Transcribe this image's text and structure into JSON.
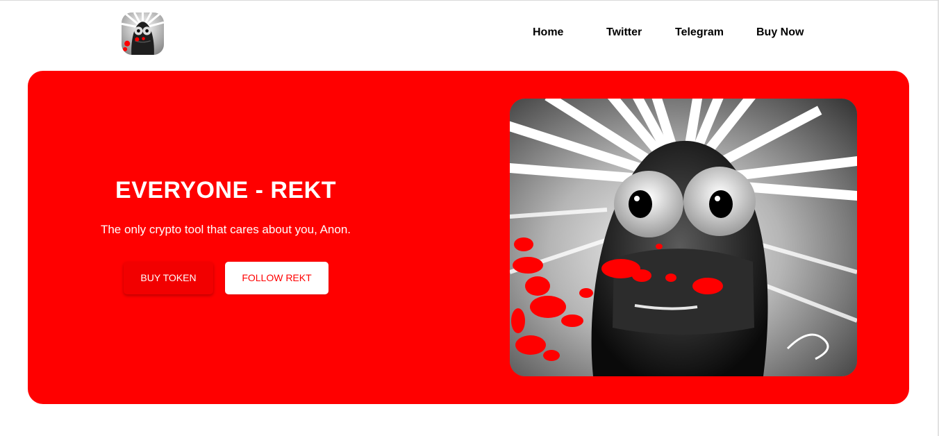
{
  "nav": {
    "items": [
      {
        "label": "Home"
      },
      {
        "label": "Twitter"
      },
      {
        "label": "Telegram"
      },
      {
        "label": "Buy Now"
      }
    ]
  },
  "hero": {
    "title": "EVERYONE - REKT",
    "subtitle": "The only crypto tool that cares about you, Anon.",
    "buy_button": "BUY TOKEN",
    "follow_button": "FOLLOW REKT"
  },
  "icons": {
    "logo": "rekt-character-logo-icon",
    "hero_image": "rekt-character-illustration"
  },
  "colors": {
    "accent": "#ff0000",
    "nav_text": "#000000",
    "hero_text": "#ffffff"
  }
}
